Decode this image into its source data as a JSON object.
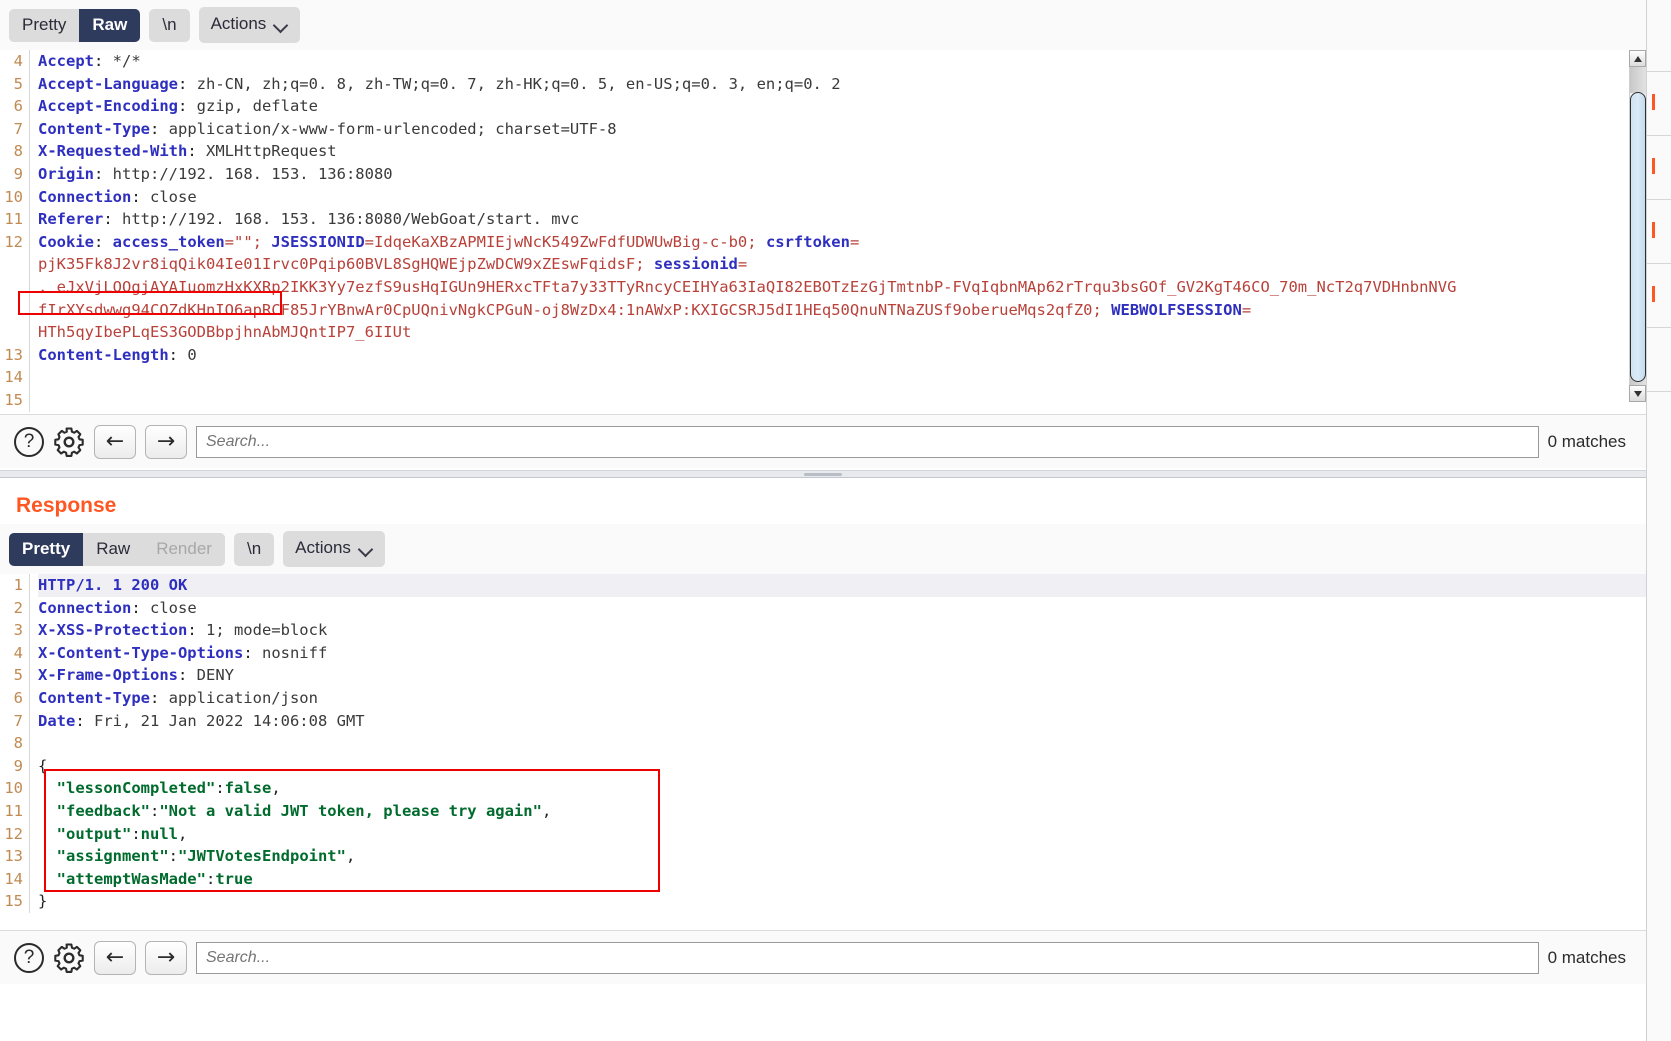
{
  "app": {
    "name": "Burp Suite HTTP message viewer"
  },
  "request": {
    "toolbar": {
      "tabs": [
        {
          "label": "Pretty",
          "state": "inactive"
        },
        {
          "label": "Raw",
          "state": "active"
        }
      ],
      "newline_label": "\\n",
      "actions_label": "Actions",
      "actions_icon": "chevron-down-icon"
    },
    "lines": [
      {
        "num": "4",
        "segments": [
          {
            "t": "Accept",
            "c": "hdr"
          },
          {
            "t": ": ",
            "c": "plain"
          },
          {
            "t": "*/*",
            "c": "val"
          }
        ]
      },
      {
        "num": "5",
        "segments": [
          {
            "t": "Accept-Language",
            "c": "hdr"
          },
          {
            "t": ": ",
            "c": "plain"
          },
          {
            "t": "zh-CN, zh;q=0. 8, zh-TW;q=0. 7, zh-HK;q=0. 5, en-US;q=0. 3, en;q=0. 2",
            "c": "val"
          }
        ]
      },
      {
        "num": "6",
        "segments": [
          {
            "t": "Accept-Encoding",
            "c": "hdr"
          },
          {
            "t": ": ",
            "c": "plain"
          },
          {
            "t": "gzip, deflate",
            "c": "val"
          }
        ]
      },
      {
        "num": "7",
        "segments": [
          {
            "t": "Content-Type",
            "c": "hdr"
          },
          {
            "t": ": ",
            "c": "plain"
          },
          {
            "t": "application/x-www-form-urlencoded; charset=UTF-8",
            "c": "val"
          }
        ]
      },
      {
        "num": "8",
        "segments": [
          {
            "t": "X-Requested-With",
            "c": "hdr"
          },
          {
            "t": ": ",
            "c": "plain"
          },
          {
            "t": "XMLHttpRequest",
            "c": "val"
          }
        ]
      },
      {
        "num": "9",
        "segments": [
          {
            "t": "Origin",
            "c": "hdr"
          },
          {
            "t": ": ",
            "c": "plain"
          },
          {
            "t": "http://192. 168. 153. 136:8080",
            "c": "val"
          }
        ]
      },
      {
        "num": "10",
        "segments": [
          {
            "t": "Connection",
            "c": "hdr"
          },
          {
            "t": ": ",
            "c": "plain"
          },
          {
            "t": "close",
            "c": "val"
          }
        ]
      },
      {
        "num": "11",
        "segments": [
          {
            "t": "Referer",
            "c": "hdr"
          },
          {
            "t": ": ",
            "c": "plain"
          },
          {
            "t": "http://192. 168. 153. 136:8080/WebGoat/start. mvc",
            "c": "val"
          }
        ]
      },
      {
        "num": "12",
        "segments": [
          {
            "t": "Cookie",
            "c": "ckblue"
          },
          {
            "t": ": ",
            "c": "plain"
          },
          {
            "t": "access_token",
            "c": "ckblue"
          },
          {
            "t": "=\"\"; ",
            "c": "ckred"
          },
          {
            "t": "JSESSIONID",
            "c": "ckblue"
          },
          {
            "t": "=IdqeKaXBzAPMIEjwNcK549ZwFdfUDWUwBig-c-b0; ",
            "c": "ckred"
          },
          {
            "t": "csrftoken",
            "c": "ckblue"
          },
          {
            "t": "=",
            "c": "ckred"
          }
        ]
      },
      {
        "num": "",
        "segments": [
          {
            "t": "pjK35Fk8J2vr8iqQik04Ie01Irvc0Pqip60BVL8SgHQWEjpZwDCW9xZEswFqidsF; ",
            "c": "ckred"
          },
          {
            "t": "sessionid",
            "c": "ckblue"
          },
          {
            "t": "=",
            "c": "ckred"
          }
        ]
      },
      {
        "num": "",
        "segments": [
          {
            "t": ". eJxVjLOOgjAYAIuomzHxKXRp2IKK3Yy7ezfS9usHqIGUn9HERxcTFta7y33TTyRncyCEIHYa63IaQI82EBOTzEzGjTmtnbP-FVqIqbnMAp62rTrqu3bsGOf_GV2KgT46CO_70m_NcT2q7VDHnbnNVG",
            "c": "ckred"
          }
        ]
      },
      {
        "num": "",
        "segments": [
          {
            "t": "fIrXYsdwwg94COZdKHnIO6apRCF85JrYBnwAr0CpUQnivNgkCPGuN-oj8WzDx4:1nAWxP:KXIGCSRJ5dI1HEq50QnuNTNaZUSf9oberueMqs2qfZ0; ",
            "c": "ckred"
          },
          {
            "t": "WEBWOLFSESSION",
            "c": "ckblue"
          },
          {
            "t": "=",
            "c": "ckred"
          }
        ]
      },
      {
        "num": "",
        "segments": [
          {
            "t": "HTh5qyIbePLqES3GODBbpjhnAbMJQntIP7_6IIUt",
            "c": "ckred"
          }
        ]
      },
      {
        "num": "13",
        "segments": [
          {
            "t": "Content-Length",
            "c": "hdr"
          },
          {
            "t": ": ",
            "c": "plain"
          },
          {
            "t": "0",
            "c": "val"
          }
        ]
      },
      {
        "num": "14",
        "segments": []
      },
      {
        "num": "15",
        "segments": []
      }
    ],
    "search": {
      "placeholder": "Search...",
      "matches_label": "0 matches",
      "help_icon": "question-mark-icon",
      "settings_icon": "gear-icon",
      "prev_icon": "arrow-left-icon",
      "next_icon": "arrow-right-icon"
    }
  },
  "response": {
    "title": "Response",
    "toolbar": {
      "tabs": [
        {
          "label": "Pretty",
          "state": "active"
        },
        {
          "label": "Raw",
          "state": "inactive"
        },
        {
          "label": "Render",
          "state": "disabled"
        }
      ],
      "newline_label": "\\n",
      "actions_label": "Actions",
      "actions_icon": "chevron-down-icon"
    },
    "lines": [
      {
        "num": "1",
        "highlight": true,
        "segments": [
          {
            "t": "HTTP/1. 1 200 OK",
            "c": "hdr"
          }
        ]
      },
      {
        "num": "2",
        "segments": [
          {
            "t": "Connection",
            "c": "hdr"
          },
          {
            "t": ": ",
            "c": "plain"
          },
          {
            "t": "close",
            "c": "val"
          }
        ]
      },
      {
        "num": "3",
        "segments": [
          {
            "t": "X-XSS-Protection",
            "c": "hdr"
          },
          {
            "t": ": ",
            "c": "plain"
          },
          {
            "t": "1; mode=block",
            "c": "val"
          }
        ]
      },
      {
        "num": "4",
        "segments": [
          {
            "t": "X-Content-Type-Options",
            "c": "hdr"
          },
          {
            "t": ": ",
            "c": "plain"
          },
          {
            "t": "nosniff",
            "c": "val"
          }
        ]
      },
      {
        "num": "5",
        "segments": [
          {
            "t": "X-Frame-Options",
            "c": "hdr"
          },
          {
            "t": ": ",
            "c": "plain"
          },
          {
            "t": "DENY",
            "c": "val"
          }
        ]
      },
      {
        "num": "6",
        "segments": [
          {
            "t": "Content-Type",
            "c": "hdr"
          },
          {
            "t": ": ",
            "c": "plain"
          },
          {
            "t": "application/json",
            "c": "val"
          }
        ]
      },
      {
        "num": "7",
        "segments": [
          {
            "t": "Date",
            "c": "hdr"
          },
          {
            "t": ": ",
            "c": "plain"
          },
          {
            "t": "Fri, 21 Jan 2022 14:06:08 GMT",
            "c": "val"
          }
        ]
      },
      {
        "num": "8",
        "segments": []
      },
      {
        "num": "9",
        "segments": [
          {
            "t": "{",
            "c": "plain"
          }
        ]
      },
      {
        "num": "10",
        "segments": [
          {
            "t": "  \"lessonCompleted\"",
            "c": "json-key"
          },
          {
            "t": ":",
            "c": "plain"
          },
          {
            "t": "false",
            "c": "json-lit"
          },
          {
            "t": ",",
            "c": "plain"
          }
        ]
      },
      {
        "num": "11",
        "segments": [
          {
            "t": "  \"feedback\"",
            "c": "json-key"
          },
          {
            "t": ":",
            "c": "plain"
          },
          {
            "t": "\"Not a valid JWT token, please try again\"",
            "c": "json-str"
          },
          {
            "t": ",",
            "c": "plain"
          }
        ]
      },
      {
        "num": "12",
        "segments": [
          {
            "t": "  \"output\"",
            "c": "json-key"
          },
          {
            "t": ":",
            "c": "plain"
          },
          {
            "t": "null",
            "c": "json-lit"
          },
          {
            "t": ",",
            "c": "plain"
          }
        ]
      },
      {
        "num": "13",
        "segments": [
          {
            "t": "  \"assignment\"",
            "c": "json-key"
          },
          {
            "t": ":",
            "c": "plain"
          },
          {
            "t": "\"JWTVotesEndpoint\"",
            "c": "json-str"
          },
          {
            "t": ",",
            "c": "plain"
          }
        ]
      },
      {
        "num": "14",
        "segments": [
          {
            "t": "  \"attemptWasMade\"",
            "c": "json-key"
          },
          {
            "t": ":",
            "c": "plain"
          },
          {
            "t": "true",
            "c": "json-lit"
          }
        ]
      },
      {
        "num": "15",
        "segments": [
          {
            "t": "}",
            "c": "plain"
          }
        ]
      }
    ],
    "search": {
      "placeholder": "Search...",
      "matches_label": "0 matches",
      "help_icon": "question-mark-icon",
      "settings_icon": "gear-icon",
      "prev_icon": "arrow-left-icon",
      "next_icon": "arrow-right-icon"
    }
  },
  "annotations": {
    "cookie_highlight": {
      "color": "#ee0000",
      "target": "Cookie: access_token=\"\";"
    },
    "json_highlight": {
      "color": "#ee0000",
      "target": "response JSON body"
    }
  },
  "icons": {
    "help": "?",
    "arrow_left": "←",
    "arrow_right": "→"
  },
  "colors": {
    "accent_orange": "#ff5722",
    "header_blue": "#2f2fbf",
    "cookie_red": "#b8413a",
    "json_green": "#006b2d",
    "tab_active": "#2f3b5c",
    "annotation_red": "#ee0000"
  }
}
